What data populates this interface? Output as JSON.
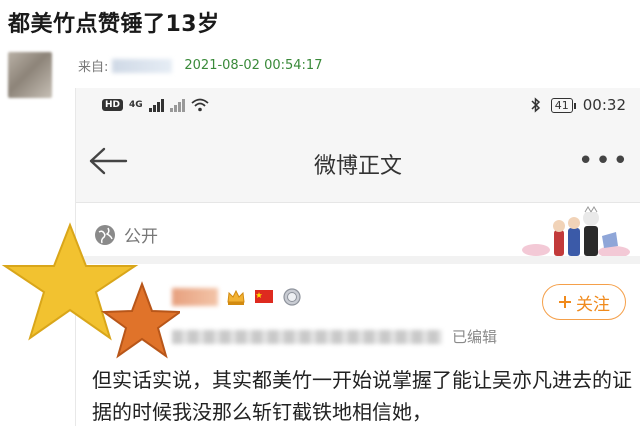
{
  "headline": "都美竹点赞锤了13岁",
  "meta": {
    "source_label": "来自:",
    "timestamp": "2021-08-02 00:54:17"
  },
  "status_bar": {
    "hd_label": "HD",
    "network_label": "4G",
    "battery": "41",
    "time": "00:32"
  },
  "nav": {
    "title": "微博正文"
  },
  "post": {
    "visibility": "公开",
    "edited_label": "已编辑",
    "follow_label": "关注",
    "body": "但实话实说，其实都美竹一开始说掌握了能让吴亦凡进去的证据的时候我没那么斩钉截铁地相信她，"
  },
  "colors": {
    "accent_orange": "#f08a1c",
    "timestamp_green": "#3a8a3a",
    "star_yellow": "#f2c230",
    "star_orange": "#e0732a"
  },
  "icons": [
    "back-arrow-icon",
    "more-dots-icon",
    "globe-icon",
    "bluetooth-icon",
    "wifi-icon",
    "signal-icon",
    "crown-icon",
    "flag-icon",
    "medal-icon",
    "plus-icon",
    "star-sticker-icon"
  ]
}
